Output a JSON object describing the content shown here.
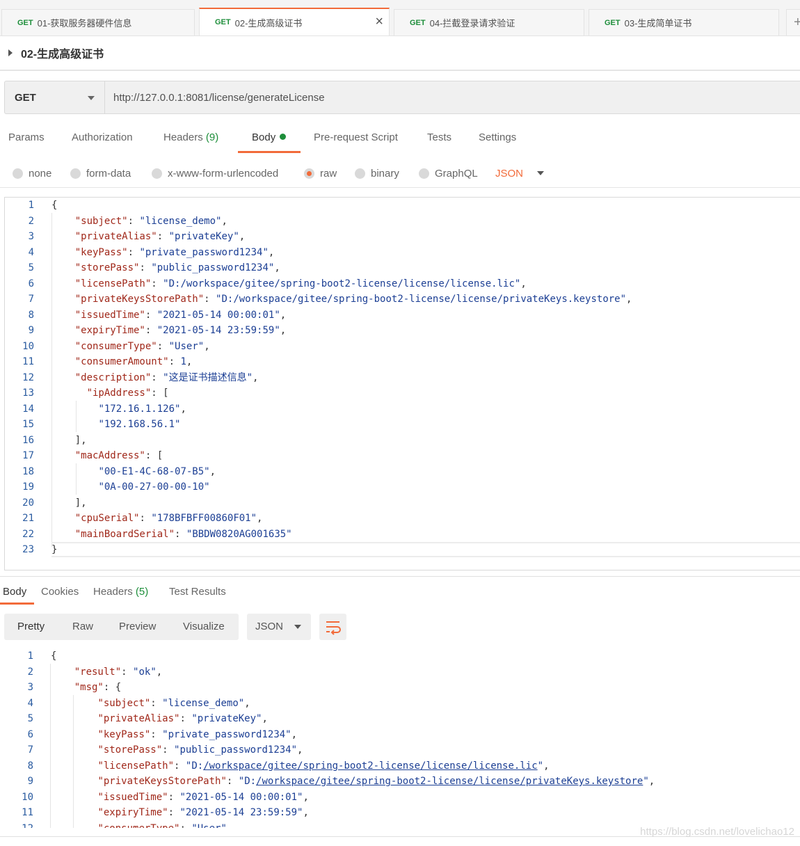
{
  "tabs": [
    {
      "method": "GET",
      "name": "01-获取服务器硬件信息"
    },
    {
      "method": "GET",
      "name": "02-生成高级证书",
      "active": true
    },
    {
      "method": "GET",
      "name": "04-拦截登录请求验证"
    },
    {
      "method": "GET",
      "name": "03-生成简单证书"
    }
  ],
  "tab_close": "×",
  "tab_plus": "+",
  "request": {
    "title": "02-生成高级证书",
    "method": "GET",
    "url": "http://127.0.0.1:8081/license/generateLicense"
  },
  "request_tabs": {
    "params": "Params",
    "authorization": "Authorization",
    "headers": "Headers",
    "headers_count": "(9)",
    "body": "Body",
    "prerequest": "Pre-request Script",
    "tests": "Tests",
    "settings": "Settings"
  },
  "body_types": {
    "none": "none",
    "form_data": "form-data",
    "urlencoded": "x-www-form-urlencoded",
    "raw": "raw",
    "binary": "binary",
    "graphql": "GraphQL",
    "format": "JSON"
  },
  "response_tabs": {
    "body": "Body",
    "cookies": "Cookies",
    "headers": "Headers",
    "headers_count": "(5)",
    "test_results": "Test Results"
  },
  "view_modes": {
    "pretty": "Pretty",
    "raw": "Raw",
    "preview": "Preview",
    "visualize": "Visualize",
    "format": "JSON"
  },
  "request_body_lines": [
    "{",
    "    \"subject\": \"license_demo\",",
    "    \"privateAlias\": \"privateKey\",",
    "    \"keyPass\": \"private_password1234\",",
    "    \"storePass\": \"public_password1234\",",
    "    \"licensePath\": \"D:/workspace/gitee/spring-boot2-license/license/license.lic\",",
    "    \"privateKeysStorePath\": \"D:/workspace/gitee/spring-boot2-license/license/privateKeys.keystore\",",
    "    \"issuedTime\": \"2021-05-14 00:00:01\",",
    "    \"expiryTime\": \"2021-05-14 23:59:59\",",
    "    \"consumerType\": \"User\",",
    "    \"consumerAmount\": 1,",
    "    \"description\": \"这是证书描述信息\",",
    "      \"ipAddress\": [",
    "        \"172.16.1.126\",",
    "        \"192.168.56.1\"",
    "    ],",
    "    \"macAddress\": [",
    "        \"00-E1-4C-68-07-B5\",",
    "        \"0A-00-27-00-00-10\"",
    "    ],",
    "    \"cpuSerial\": \"178BFBFF00860F01\",",
    "    \"mainBoardSerial\": \"BBDW0820AG001635\"",
    "}"
  ],
  "response_body_lines": [
    "{",
    "    \"result\": \"ok\",",
    "    \"msg\": {",
    "        \"subject\": \"license_demo\",",
    "        \"privateAlias\": \"privateKey\",",
    "        \"keyPass\": \"private_password1234\",",
    "        \"storePass\": \"public_password1234\",",
    "        \"licensePath\": \"D:/workspace/gitee/spring-boot2-license/license/license.lic\",",
    "        \"privateKeysStorePath\": \"D:/workspace/gitee/spring-boot2-license/license/privateKeys.keystore\",",
    "        \"issuedTime\": \"2021-05-14 00:00:01\",",
    "        \"expiryTime\": \"2021-05-14 23:59:59\",",
    "        \"consumerType\": \"User\","
  ],
  "watermark": "https://blog.csdn.net/lovelichao12",
  "colors": {
    "accent": "#f26b3a",
    "get_method": "#1d8e3a",
    "json_key": "#a0281a",
    "json_string": "#1c3f94"
  }
}
